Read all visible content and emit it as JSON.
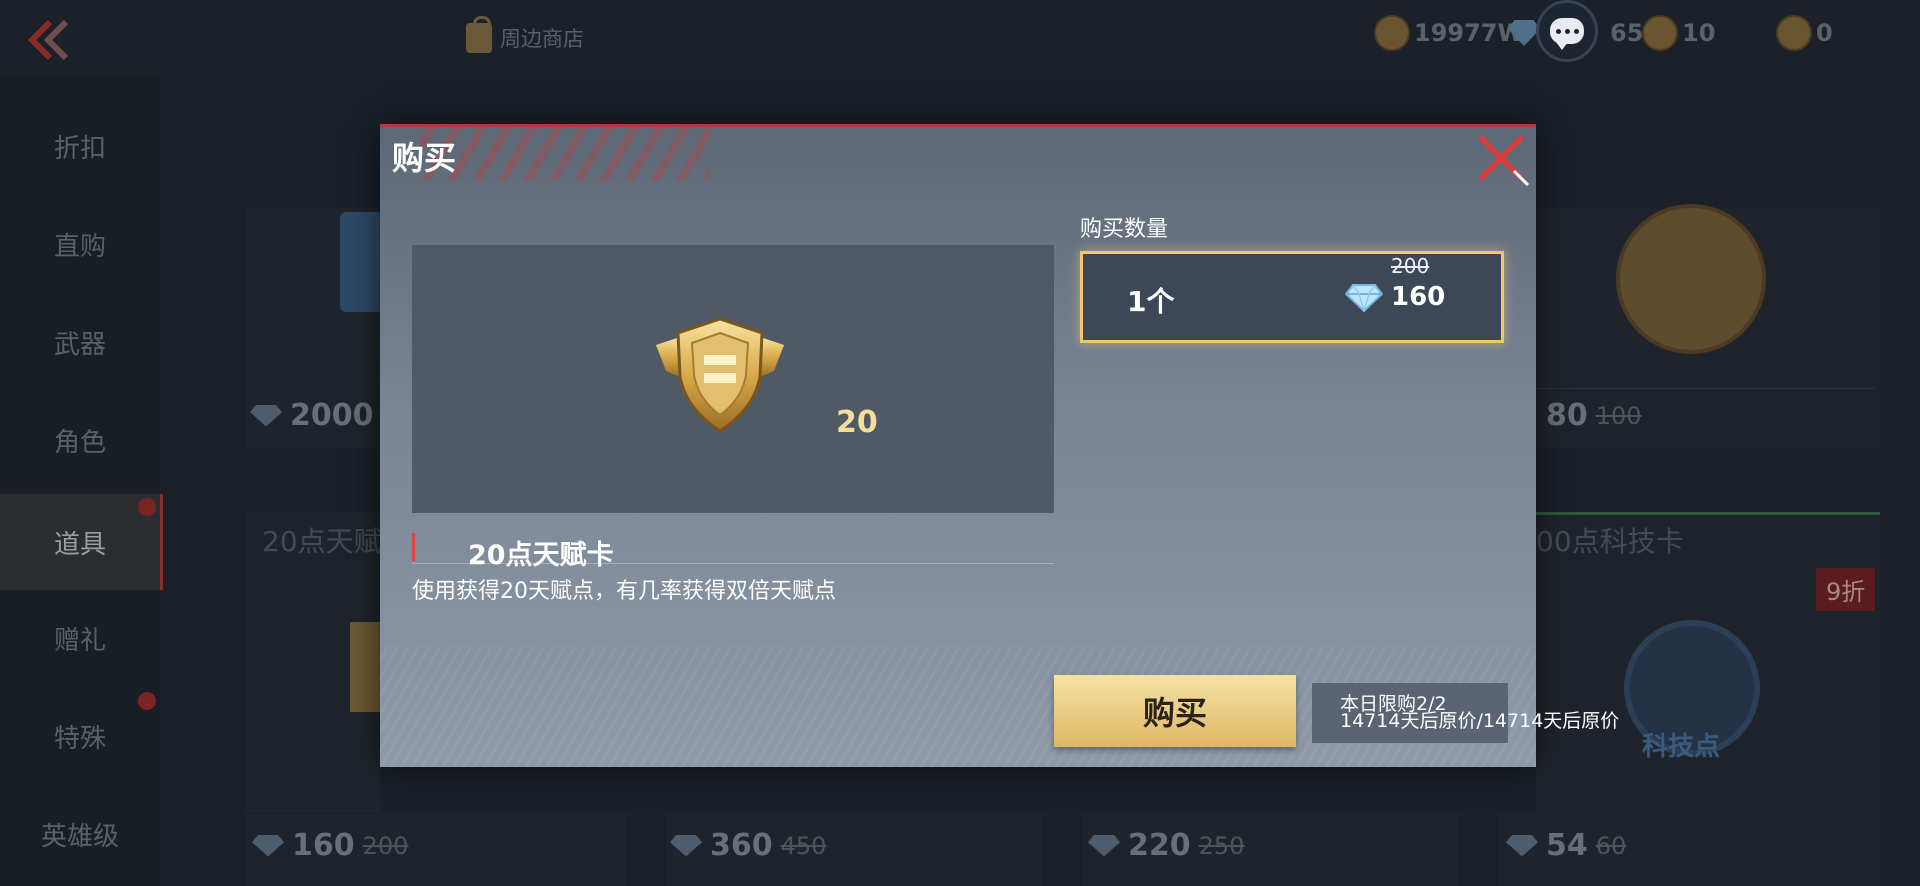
{
  "topbar": {
    "shop_label": "周边商店",
    "currencies": [
      {
        "icon": "gold-coin-icon",
        "value": "19977W"
      },
      {
        "icon": "diamond-icon",
        "value": "659"
      },
      {
        "icon": "medal-coin-icon",
        "value": "10"
      },
      {
        "icon": "token-coin-icon",
        "value": "0"
      }
    ]
  },
  "sidebar": {
    "items": [
      {
        "label": "折扣",
        "active": false
      },
      {
        "label": "直购",
        "active": false
      },
      {
        "label": "武器",
        "active": false
      },
      {
        "label": "角色",
        "active": false
      },
      {
        "label": "道具",
        "active": true
      },
      {
        "label": "赠礼",
        "active": false
      },
      {
        "label": "特殊",
        "active": false
      },
      {
        "label": "英雄级",
        "active": false
      }
    ]
  },
  "background_cards": {
    "top_left_price": "2000",
    "top_right_price": "80",
    "top_right_old": "100",
    "mid_left_title": "20点天赋",
    "mid_right_title": "00点科技卡",
    "mid_right_discount": "9折",
    "mid_right_tech_label": "科技点",
    "bottom_prices": [
      {
        "price": "160",
        "old": "200"
      },
      {
        "price": "360",
        "old": "450"
      },
      {
        "price": "220",
        "old": "250"
      },
      {
        "price": "54",
        "old": "60"
      }
    ]
  },
  "modal": {
    "title": "购买",
    "item": {
      "count": "20",
      "name": "20点天赋卡",
      "description": "使用获得20天赋点，有几率获得双倍天赋点"
    },
    "quantity": {
      "label": "购买数量",
      "value": "1个",
      "old_price": "200",
      "price": "160"
    },
    "buy_label": "购买",
    "limit_line1": "本日限购2/2",
    "limit_line2": "14714天后原价/14714天后原价"
  },
  "colors": {
    "accent_gold": "#f1c76a",
    "close_red": "#e03a3a",
    "modal_top_border": "#b33a3a"
  }
}
